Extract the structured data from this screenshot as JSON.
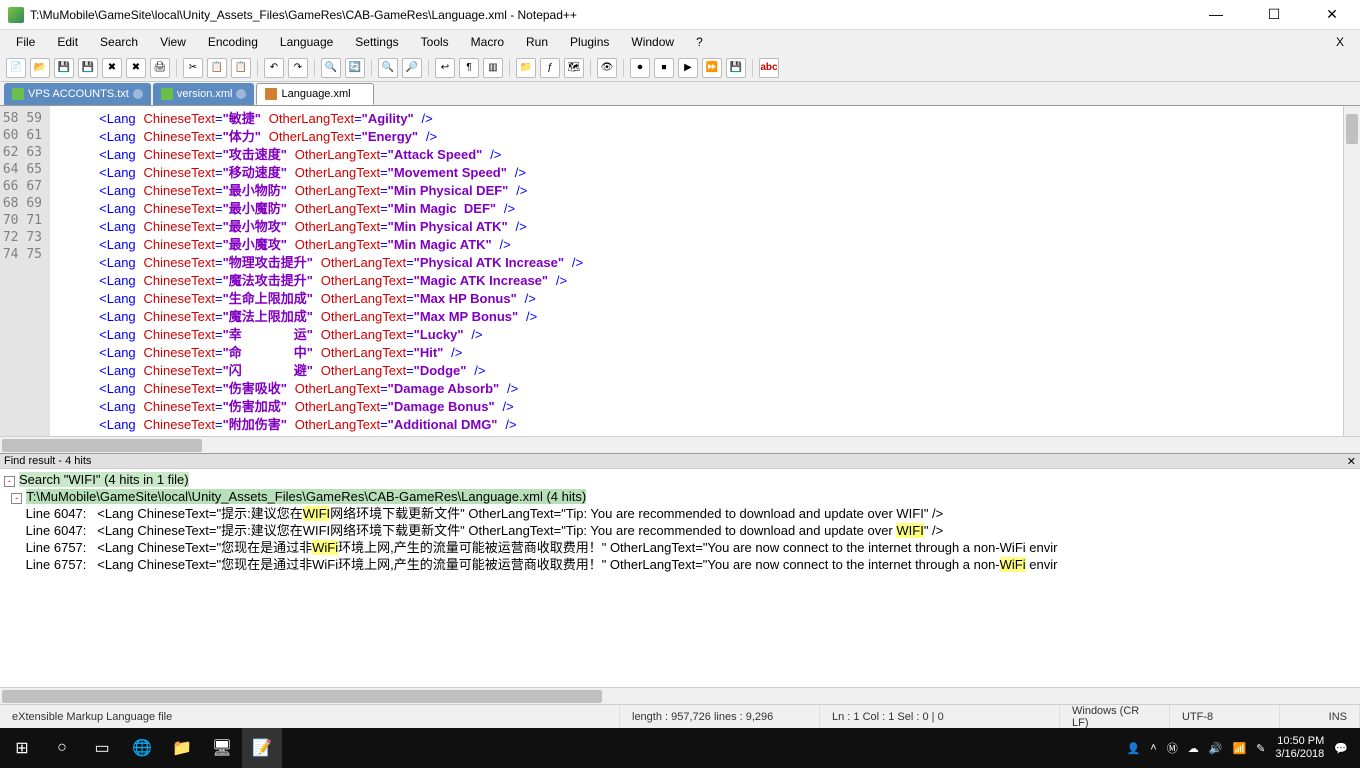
{
  "title": "T:\\MuMobile\\GameSite\\local\\Unity_Assets_Files\\GameRes\\CAB-GameRes\\Language.xml - Notepad++",
  "menus": [
    "File",
    "Edit",
    "Search",
    "View",
    "Encoding",
    "Language",
    "Settings",
    "Tools",
    "Macro",
    "Run",
    "Plugins",
    "Window",
    "?"
  ],
  "tabs": [
    {
      "label": "VPS ACCOUNTS.txt",
      "active": false
    },
    {
      "label": "version.xml",
      "active": false
    },
    {
      "label": "Language.xml",
      "active": true
    }
  ],
  "code_lines": [
    {
      "n": 58,
      "cn": "敏捷",
      "en": "Agility"
    },
    {
      "n": 59,
      "cn": "体力",
      "en": "Energy"
    },
    {
      "n": 60,
      "cn": "攻击速度",
      "en": "Attack Speed"
    },
    {
      "n": 61,
      "cn": "移动速度",
      "en": "Movement Speed"
    },
    {
      "n": 62,
      "cn": "最小物防",
      "en": "Min Physical DEF"
    },
    {
      "n": 63,
      "cn": "最小魔防",
      "en": "Min Magic  DEF"
    },
    {
      "n": 64,
      "cn": "最小物攻",
      "en": "Min Physical ATK"
    },
    {
      "n": 65,
      "cn": "最小魔攻",
      "en": "Min Magic ATK"
    },
    {
      "n": 66,
      "cn": "物理攻击提升",
      "en": "Physical ATK Increase"
    },
    {
      "n": 67,
      "cn": "魔法攻击提升",
      "en": "Magic ATK Increase"
    },
    {
      "n": 68,
      "cn": "生命上限加成",
      "en": "Max HP Bonus"
    },
    {
      "n": 69,
      "cn": "魔法上限加成",
      "en": "Max MP Bonus"
    },
    {
      "n": 70,
      "cn": "幸　　　　运",
      "en": "Lucky"
    },
    {
      "n": 71,
      "cn": "命　　　　中",
      "en": "Hit"
    },
    {
      "n": 72,
      "cn": "闪　　　　避",
      "en": "Dodge"
    },
    {
      "n": 73,
      "cn": "伤害吸收",
      "en": "Damage Absorb"
    },
    {
      "n": 74,
      "cn": "伤害加成",
      "en": "Damage Bonus"
    },
    {
      "n": 75,
      "cn": "附加伤害",
      "en": "Additional DMG"
    }
  ],
  "find": {
    "header": "Find result - 4 hits",
    "search_line": "Search \"WIFI\" (4 hits in 1 file)",
    "file_line": "T:\\MuMobile\\GameSite\\local\\Unity_Assets_Files\\GameRes\\CAB-GameRes\\Language.xml (4 hits)",
    "results": [
      {
        "line": "6047",
        "pre": "<Lang ChineseText=\"提示:建议您在",
        "m": "WIFI",
        "post": "网络环境下载更新文件\" OtherLangText=\"Tip: You are recommended to download and update over WIFI\" />"
      },
      {
        "line": "6047",
        "pre": "<Lang ChineseText=\"提示:建议您在WIFI网络环境下载更新文件\" OtherLangText=\"Tip: You are recommended to download and update over ",
        "m": "WIFI",
        "post": "\" />"
      },
      {
        "line": "6757",
        "pre": "<Lang ChineseText=\"您现在是通过非",
        "m": "WiFi",
        "post": "环境上网,产生的流量可能被运营商收取费用！\" OtherLangText=\"You are now connect to the internet through a non-WiFi envir"
      },
      {
        "line": "6757",
        "pre": "<Lang ChineseText=\"您现在是通过非WiFi环境上网,产生的流量可能被运营商收取费用！\" OtherLangText=\"You are now connect to the internet through a non-",
        "m": "WiFi",
        "post": " envir"
      }
    ]
  },
  "status": {
    "type": "eXtensible Markup Language file",
    "length": "length : 957,726    lines : 9,296",
    "pos": "Ln : 1    Col : 1    Sel : 0 | 0",
    "eol": "Windows (CR LF)",
    "enc": "UTF-8",
    "ins": "INS"
  },
  "tray": {
    "time": "10:50 PM",
    "date": "3/16/2018"
  }
}
